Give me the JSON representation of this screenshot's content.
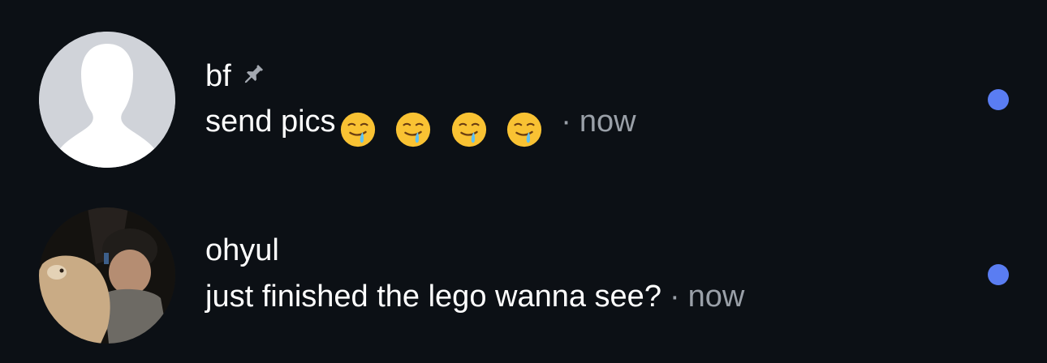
{
  "accent_unread": "#5a7df2",
  "background": "#0c1015",
  "conversations": [
    {
      "name": "bf",
      "pinned": true,
      "pin_icon": "pin-icon",
      "avatar": "default-avatar-silhouette",
      "preview": "send pics",
      "preview_emojis": [
        "drooling-face-emoji",
        "drooling-face-emoji",
        "drooling-face-emoji",
        "drooling-face-emoji"
      ],
      "separator": "·",
      "time": "now",
      "unread": true
    },
    {
      "name": "ohyul",
      "pinned": false,
      "avatar": "user-photo",
      "preview": "just finished the lego wanna see?",
      "separator": "·",
      "time": "now",
      "unread": true
    }
  ]
}
